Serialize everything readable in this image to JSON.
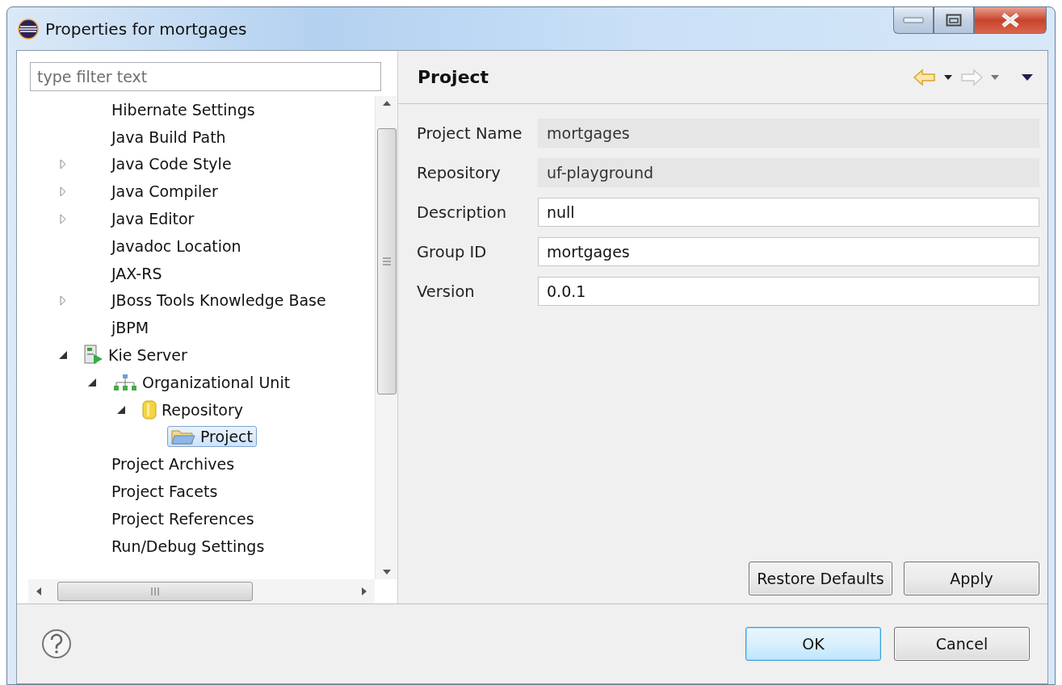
{
  "window": {
    "title": "Properties for mortgages"
  },
  "filter": {
    "placeholder": "type filter text"
  },
  "tree": [
    {
      "label": "Hibernate Settings",
      "kind": "page"
    },
    {
      "label": "Java Build Path",
      "kind": "page"
    },
    {
      "label": "Java Code Style",
      "kind": "page",
      "expanded": false
    },
    {
      "label": "Java Compiler",
      "kind": "page",
      "expanded": false
    },
    {
      "label": "Java Editor",
      "kind": "page",
      "expanded": false
    },
    {
      "label": "Javadoc Location",
      "kind": "page"
    },
    {
      "label": "JAX-RS",
      "kind": "page"
    },
    {
      "label": "JBoss Tools Knowledge Base",
      "kind": "page",
      "expanded": false
    },
    {
      "label": "jBPM",
      "kind": "page"
    },
    {
      "label": "Kie Server",
      "kind": "server",
      "expanded": true,
      "selected": false,
      "children": [
        {
          "label": "Organizational Unit",
          "kind": "unit",
          "expanded": true,
          "selected": false,
          "children": [
            {
              "label": "Repository",
              "kind": "repository",
              "expanded": true,
              "selected": false,
              "children": [
                {
                  "label": "Project",
                  "kind": "project",
                  "selected": true
                }
              ]
            }
          ]
        }
      ]
    },
    {
      "label": "Project Archives",
      "kind": "page"
    },
    {
      "label": "Project Facets",
      "kind": "page"
    },
    {
      "label": "Project References",
      "kind": "page"
    },
    {
      "label": "Run/Debug Settings",
      "kind": "page"
    }
  ],
  "page": {
    "title": "Project"
  },
  "fields": [
    {
      "label": "Project Name",
      "value": "mortgages",
      "disabled": true
    },
    {
      "label": "Repository",
      "value": "uf-playground",
      "disabled": true
    },
    {
      "label": "Description",
      "value": "null",
      "disabled": false
    },
    {
      "label": "Group ID",
      "value": "mortgages",
      "disabled": false
    },
    {
      "label": "Version",
      "value": "0.0.1",
      "disabled": false
    }
  ],
  "page_buttons": [
    {
      "label": "Restore Defaults"
    },
    {
      "label": "Apply"
    }
  ],
  "dialog_buttons": [
    {
      "label": "OK",
      "default": true
    },
    {
      "label": "Cancel",
      "default": false
    }
  ]
}
